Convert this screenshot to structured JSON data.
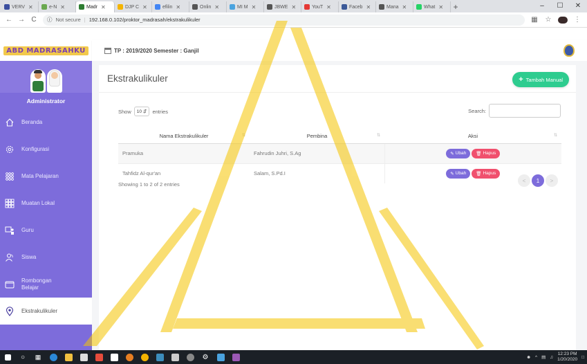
{
  "browser": {
    "tabs": [
      {
        "label": "VERV",
        "color": "#3c4fa0"
      },
      {
        "label": "e-N",
        "color": "#6aa84f"
      },
      {
        "label": "Madr",
        "color": "#2e7d32",
        "active": true
      },
      {
        "label": "DJP C",
        "color": "#f4b400"
      },
      {
        "label": "efilin",
        "color": "#4285f4"
      },
      {
        "label": "Onlin",
        "color": "#555555"
      },
      {
        "label": "MI M",
        "color": "#4aa3df"
      },
      {
        "label": "JBWE",
        "color": "#555555"
      },
      {
        "label": "YouT",
        "color": "#e53935"
      },
      {
        "label": "Faceb",
        "color": "#3b5998"
      },
      {
        "label": "Mana",
        "color": "#555555"
      },
      {
        "label": "What",
        "color": "#25d366"
      }
    ],
    "new_tab": "+",
    "window_controls": [
      "–",
      "☐",
      "✕"
    ],
    "back": "←",
    "forward": "→",
    "reload": "C",
    "security": "Not secure",
    "url": "192.168.0.102/proktor_madrasah/ekstrakulikuler"
  },
  "app": {
    "logo_text": "ABD MADRASAHKU",
    "period": "TP : 2019/2020  Semester : Ganjil",
    "user_role": "Administrator"
  },
  "sidebar": {
    "items": [
      {
        "label": "Beranda",
        "icon": "home-icon"
      },
      {
        "label": "Konfigurasi",
        "icon": "gear-icon"
      },
      {
        "label": "Mata Pelajaran",
        "icon": "grid-dots-icon"
      },
      {
        "label": "Muatan Lokal",
        "icon": "grid-squares-icon"
      },
      {
        "label": "Guru",
        "icon": "teacher-icon"
      },
      {
        "label": "Siswa",
        "icon": "students-icon"
      },
      {
        "label": "Rombongan Belajar",
        "icon": "folder-icon"
      },
      {
        "label": "Ekstrakulikuler",
        "icon": "location-pin-icon",
        "active": true
      }
    ]
  },
  "main": {
    "title": "Ekstrakulikuler",
    "add_button": "Tambah Manual",
    "show_label": "Show",
    "entries_value": "10",
    "entries_label": "entries",
    "search_label": "Search:",
    "search_value": "",
    "columns": [
      "Nama Ekstrakulikuler",
      "Pembina",
      "Aksi"
    ],
    "rows": [
      {
        "nama": "Pramuka",
        "pembina": "Fahrudin Juhri, S.Ag"
      },
      {
        "nama": "Tahfidz Al-qur'an",
        "pembina": "Salam, S.Pd.I"
      }
    ],
    "edit_label": "Ubah",
    "delete_label": "Hapus",
    "info": "Showing 1 to 2 of 2 entries",
    "pagination": {
      "prev": "<",
      "current": "1",
      "next": ">"
    }
  },
  "taskbar": {
    "time": "12:23 PM",
    "date": "1/20/2020"
  },
  "colors": {
    "sidebar": "#7d6cdb",
    "accent_green": "#2ecc8f",
    "danger": "#f0506e",
    "watermark": "#f5c400"
  }
}
